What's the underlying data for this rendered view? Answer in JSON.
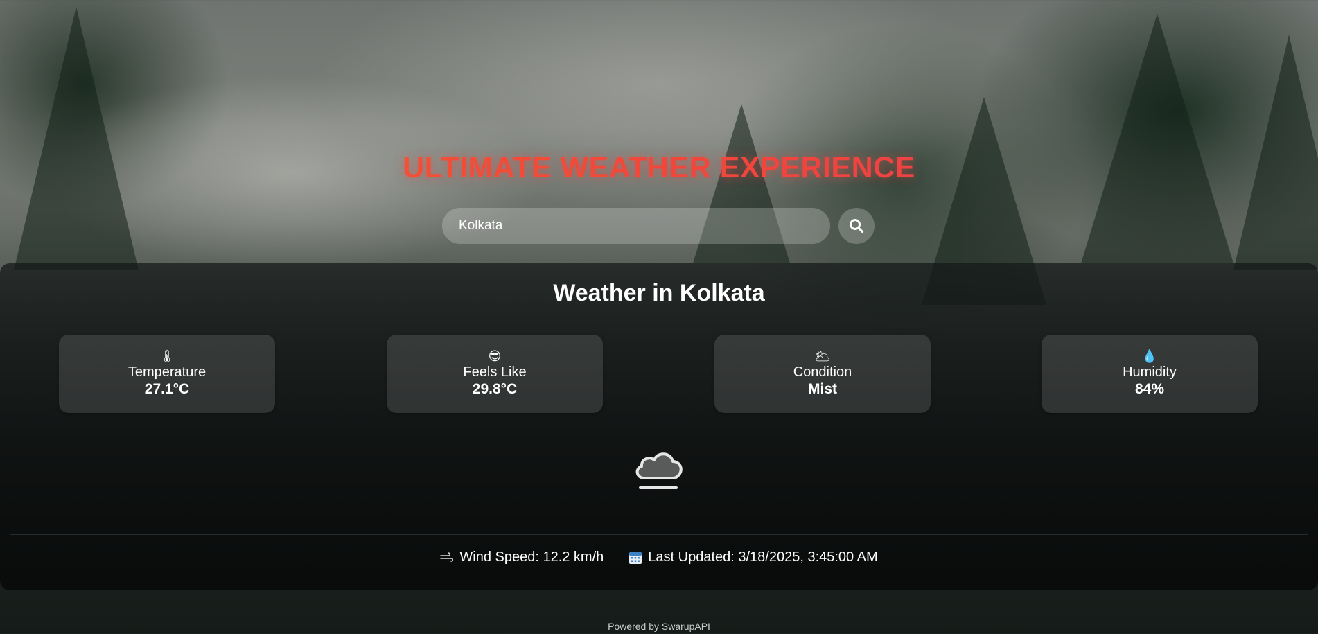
{
  "header": {
    "title": "ULTIMATE WEATHER EXPERIENCE"
  },
  "search": {
    "value": "Kolkata",
    "button_icon": "search-icon"
  },
  "weather": {
    "title": "Weather in Kolkata",
    "cards": [
      {
        "icon": "🌡",
        "icon_name": "thermometer-icon",
        "label": "Temperature",
        "value": "27.1°C"
      },
      {
        "icon": "😎",
        "icon_name": "sunglasses-face-icon",
        "label": "Feels Like",
        "value": "29.8°C"
      },
      {
        "icon": "🌥",
        "icon_name": "cloud-sun-icon",
        "label": "Condition",
        "value": "Mist"
      },
      {
        "icon": "💧",
        "icon_name": "droplet-icon",
        "label": "Humidity",
        "value": "84%"
      }
    ],
    "condition_icon": "mist-cloud-icon",
    "wind": {
      "icon": "wind-icon",
      "text": "Wind Speed: 12.2 km/h"
    },
    "updated": {
      "icon": "calendar-icon",
      "text": "Last Updated: 3/18/2025, 3:45:00 AM"
    }
  },
  "footer": {
    "powered_by": "Powered by SwarupAPI"
  },
  "colors": {
    "title_gradient_start": "#f6642f",
    "title_gradient_end": "#e93a58"
  }
}
